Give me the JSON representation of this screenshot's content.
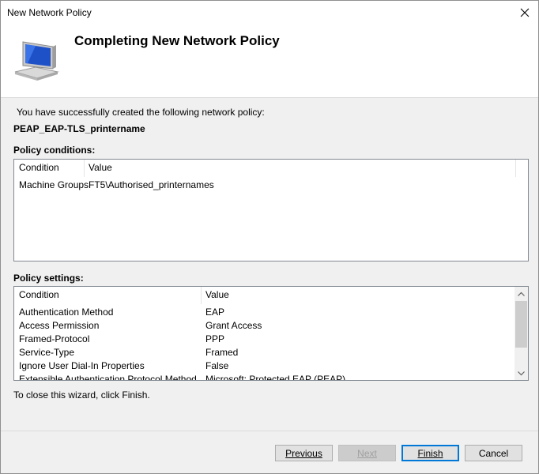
{
  "window": {
    "title": "New Network Policy"
  },
  "header": {
    "title": "Completing New Network Policy"
  },
  "summary": {
    "success_message": "You have successfully created the following network policy:",
    "policy_name": "PEAP_EAP-TLS_printername"
  },
  "conditions": {
    "label": "Policy conditions:",
    "columns": [
      "Condition",
      "Value"
    ],
    "rows": [
      {
        "condition": "Machine Groups",
        "value": "FT5\\Authorised_printernames"
      }
    ]
  },
  "settings": {
    "label": "Policy settings:",
    "columns": [
      "Condition",
      "Value"
    ],
    "rows": [
      {
        "condition": "Authentication Method",
        "value": "EAP"
      },
      {
        "condition": "Access Permission",
        "value": "Grant Access"
      },
      {
        "condition": "Framed-Protocol",
        "value": "PPP"
      },
      {
        "condition": "Service-Type",
        "value": "Framed"
      },
      {
        "condition": "Ignore User Dial-In Properties",
        "value": "False"
      },
      {
        "condition": "Extensible Authentication Protocol Method",
        "value": "Microsoft: Protected EAP (PEAP)"
      }
    ]
  },
  "footer": {
    "close_message": "To close this wizard, click Finish.",
    "previous_label": "Previous",
    "next_label": "Next",
    "finish_label": "Finish",
    "cancel_label": "Cancel"
  },
  "icons": {
    "close": "close-icon",
    "header": "computer-monitor-icon"
  }
}
